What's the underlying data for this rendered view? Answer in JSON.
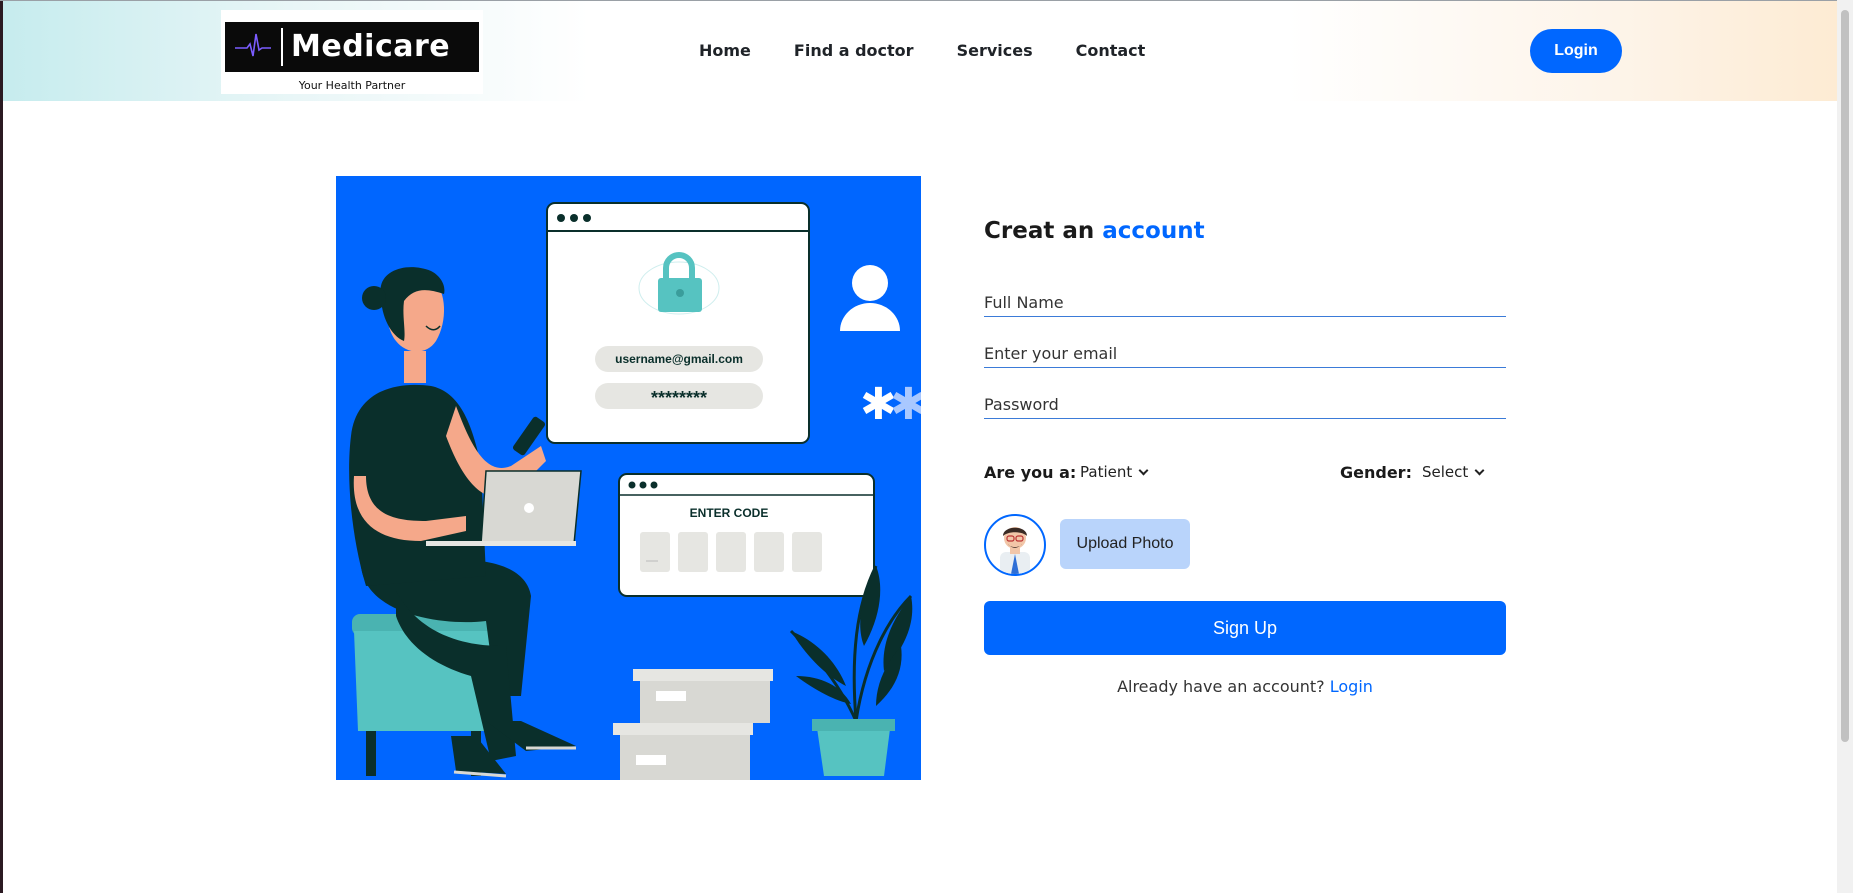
{
  "brand": {
    "name": "Medicare",
    "tagline": "Your Health Partner"
  },
  "nav": {
    "items": [
      "Home",
      "Find a doctor",
      "Services",
      "Contact"
    ],
    "login_label": "Login"
  },
  "illustration": {
    "email_text": "username@gmail.com",
    "password_text": "********",
    "code_title": "ENTER CODE"
  },
  "form": {
    "title_prefix": "Creat an",
    "title_accent": "account",
    "full_name_placeholder": "Full Name",
    "email_placeholder": "Enter your email",
    "password_placeholder": "Password",
    "role_label": "Are you a:",
    "role_value": "Patient",
    "gender_label": "Gender:",
    "gender_value": "Select",
    "upload_label": "Upload Photo",
    "signup_label": "Sign Up",
    "already_text": "Already have an account?",
    "login_link": "Login"
  },
  "colors": {
    "primary": "#0067ff",
    "illustration_bg": "#0066ff",
    "upload_button_bg": "#b9d4fb",
    "teal": "#56c3c1",
    "dark_green": "#0a2f2b"
  },
  "icons": {
    "logo_mark": "heartbeat-icon",
    "avatar": "doctor-avatar-icon",
    "dropdown": "chevron-down-icon"
  }
}
